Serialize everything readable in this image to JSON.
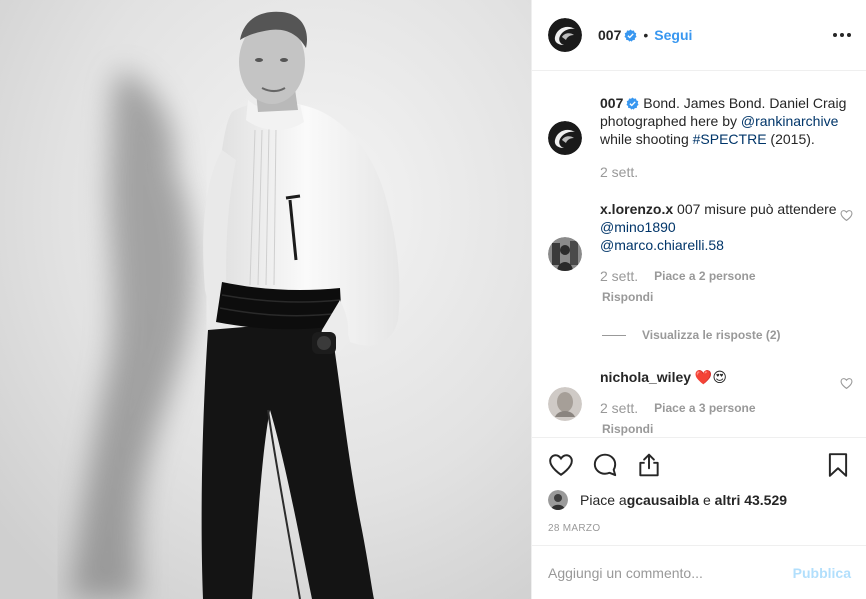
{
  "post": {
    "username": "007",
    "separator": "•",
    "follow_label": "Segui",
    "more_label": "Altro"
  },
  "caption": {
    "username": "007",
    "text_before": " Bond. James Bond. Daniel Craig photographed here by ",
    "mention": "@rankinarchive",
    "text_middle": " while shooting ",
    "hashtag": "#SPECTRE",
    "text_after": " (2015).",
    "time": "2 sett."
  },
  "comments": [
    {
      "username": "x.lorenzo.x",
      "text": " 007 misure può attendere ",
      "mentions": [
        "@mino1890",
        "@marco.chiarelli.58"
      ],
      "time": "2 sett.",
      "likes": "Piace a 2 persone",
      "reply": "Rispondi",
      "view_replies": "Visualizza le risposte (2)"
    },
    {
      "username": "nichola_wiley",
      "text": " ❤️😍",
      "time": "2 sett.",
      "likes": "Piace a 3 persone",
      "reply": "Rispondi"
    }
  ],
  "likes_summary": {
    "prefix": "Piace a ",
    "user": "gcausaibla",
    "middle": " e ",
    "others": "altri 43.529"
  },
  "date": "28 MARZO",
  "add_comment": {
    "placeholder": "Aggiungi un commento...",
    "publish_label": "Pubblica"
  },
  "icons": {
    "like": "heart-icon",
    "comment": "comment-icon",
    "share": "share-icon",
    "save": "bookmark-icon",
    "verified": "verified-badge-icon",
    "more": "more-options-icon"
  },
  "colors": {
    "accent": "#3897f0",
    "link": "#003569",
    "muted": "#999999",
    "text": "#262626",
    "publish_disabled": "#b2dffc"
  }
}
